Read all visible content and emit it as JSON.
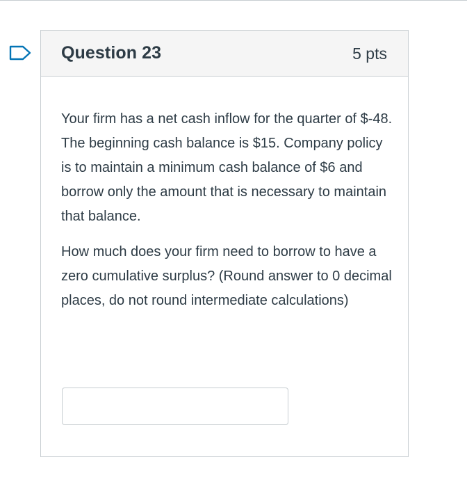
{
  "question": {
    "title": "Question 23",
    "points": "5 pts",
    "paragraphs": [
      "Your firm has a net cash inflow for the quarter of $-48. The beginning cash balance is $15. Company policy is to maintain a minimum cash balance of $6 and borrow only the amount that is necessary to maintain that balance.",
      "How much does your firm need to borrow to have a zero cumulative surplus? (Round answer to 0 decimal places, do not round intermediate calculations)"
    ],
    "answer": {
      "value": "",
      "placeholder": ""
    }
  },
  "icons": {
    "flag": "flag-question-icon"
  },
  "colors": {
    "flag_outline": "#0374b5",
    "border": "#c7cdd1",
    "header_background": "#f5f5f5",
    "text": "#2d3b45"
  }
}
